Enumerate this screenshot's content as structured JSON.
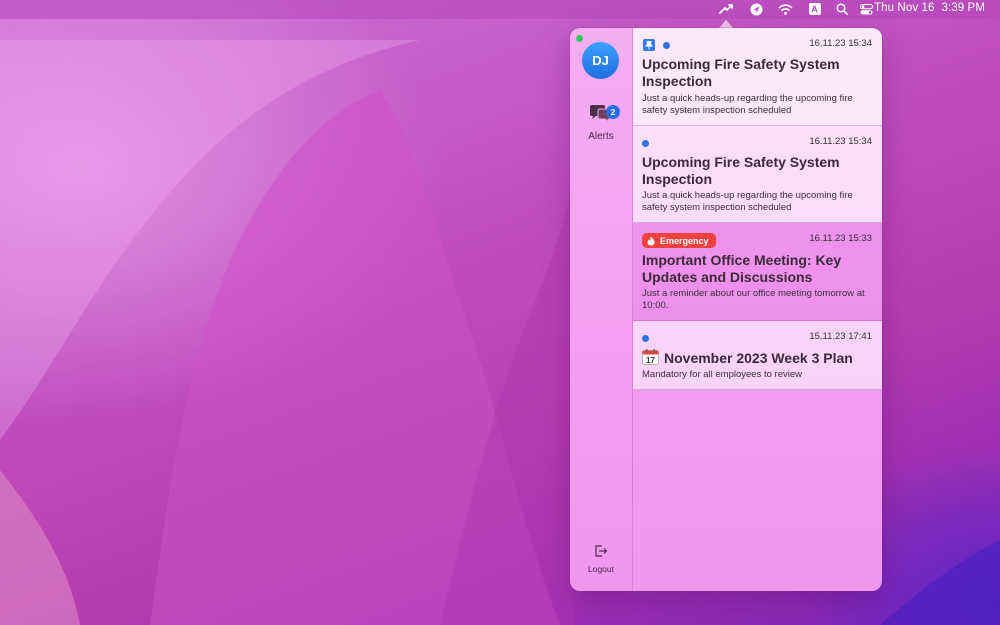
{
  "menubar": {
    "icons": [
      "alerts-app-icon",
      "location-icon",
      "wifi-icon",
      "keyboard-input-icon",
      "search-icon",
      "control-center-icon"
    ],
    "input_source": "A",
    "date": "Thu Nov 16",
    "time": "3:39 PM"
  },
  "sidebar": {
    "avatar_initials": "DJ",
    "online_status_color": "#34c759",
    "alerts_label": "Alerts",
    "alerts_badge": "2",
    "logout_label": "Logout"
  },
  "notifications": [
    {
      "timestamp": "16.11.23 15:34",
      "title": "Upcoming Fire Safety System Inspection",
      "body": "Just a quick heads-up regarding the upcoming fire safety system inspection scheduled",
      "pinned": true,
      "unread": true
    },
    {
      "timestamp": "16.11.23 15:34",
      "title": "Upcoming Fire Safety System Inspection",
      "body": "Just a quick heads-up regarding the upcoming fire safety system inspection scheduled",
      "unread": true
    },
    {
      "timestamp": "16.11.23 15:33",
      "badge": "Emergency",
      "title": "Important Office Meeting: Key Updates and Discussions",
      "body": "Just a reminder about our office meeting tomorrow at 10:00."
    },
    {
      "timestamp": "15.11.23 17:41",
      "title": "November 2023 Week 3 Plan",
      "title_icon": "calendar-icon",
      "body": "Mandatory for all employees to review",
      "unread": true
    }
  ],
  "colors": {
    "accent_blue": "#2f6fe8",
    "emergency_red": "#f0413c"
  }
}
